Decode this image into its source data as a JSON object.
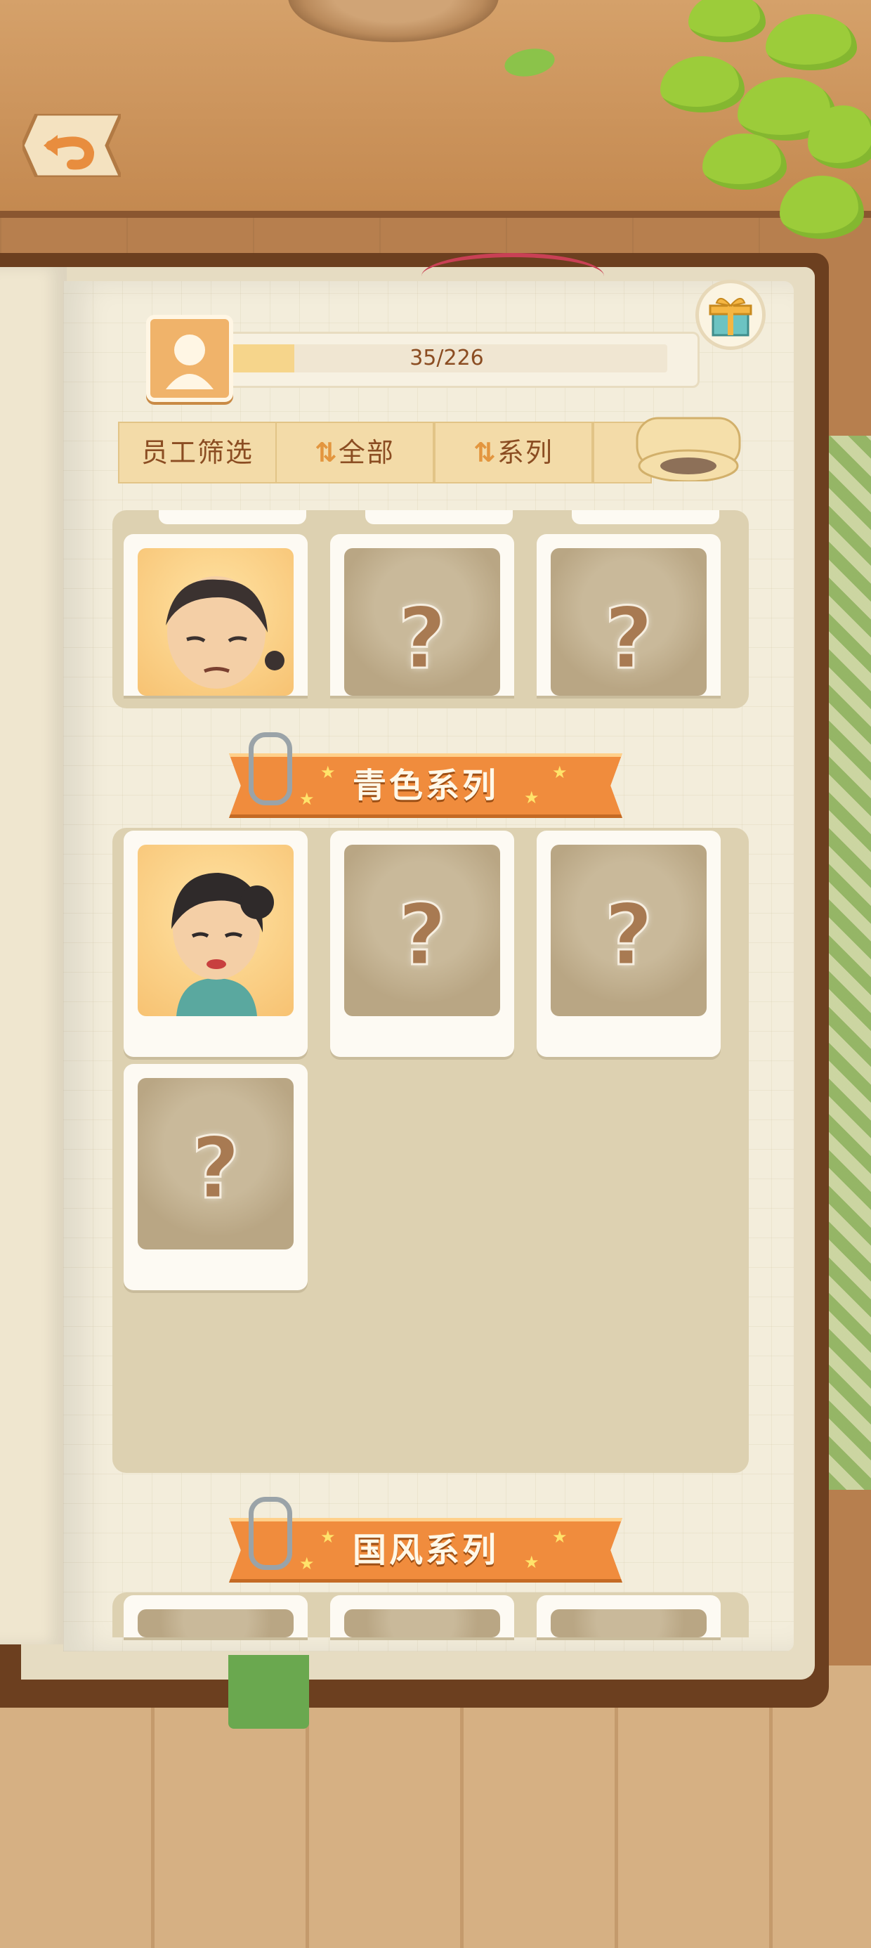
{
  "progress": {
    "text": "35/226",
    "fraction": 0.155
  },
  "filter_bar": {
    "filter_label": "员工筛选",
    "sort_all_label": "全部",
    "sort_series_label": "系列"
  },
  "series": [
    {
      "title": "",
      "cards": [
        {
          "state": "unlocked",
          "character": "elderly-woman"
        },
        {
          "state": "locked",
          "mark": "?"
        },
        {
          "state": "locked",
          "mark": "?"
        }
      ]
    },
    {
      "title": "青色系列",
      "cards": [
        {
          "state": "unlocked",
          "character": "woman-teal"
        },
        {
          "state": "locked",
          "mark": "?"
        },
        {
          "state": "locked",
          "mark": "?"
        },
        {
          "state": "locked",
          "mark": "?"
        }
      ]
    },
    {
      "title": "国风系列",
      "cards": [
        {
          "state": "locked"
        },
        {
          "state": "locked"
        },
        {
          "state": "locked"
        }
      ]
    }
  ],
  "icons": {
    "back": "back-arrow-icon",
    "avatar": "staff-avatar-icon",
    "gift": "gift-box-icon",
    "sort": "sort-arrows-icon"
  },
  "colors": {
    "accent": "#f08c3d",
    "text_brown": "#8b4d22",
    "panel": "#ddd1b1"
  }
}
